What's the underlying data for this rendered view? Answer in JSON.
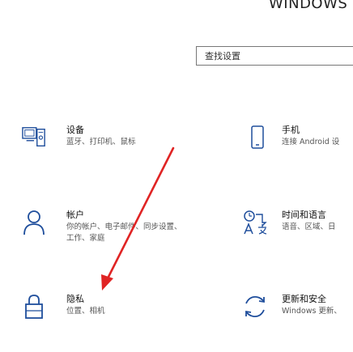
{
  "window": {
    "title": "WINDOWS"
  },
  "search": {
    "placeholder": "查找设置"
  },
  "tiles": [
    {
      "title": "设备",
      "desc": "蓝牙、打印机、鼠标",
      "icon": "devices-icon"
    },
    {
      "title": "手机",
      "desc": "连接 Android 设",
      "icon": "phone-icon"
    },
    {
      "title": "帐户",
      "desc": "你的帐户、电子邮件、同步设置、工作、家庭",
      "icon": "person-icon"
    },
    {
      "title": "时间和语言",
      "desc": "语音、区域、日",
      "icon": "time-language-icon"
    },
    {
      "title": "隐私",
      "desc": "位置、相机",
      "icon": "lock-icon"
    },
    {
      "title": "更新和安全",
      "desc": "Windows 更新、",
      "icon": "update-icon"
    }
  ],
  "annotation": {
    "arrow_color": "#e02424"
  }
}
